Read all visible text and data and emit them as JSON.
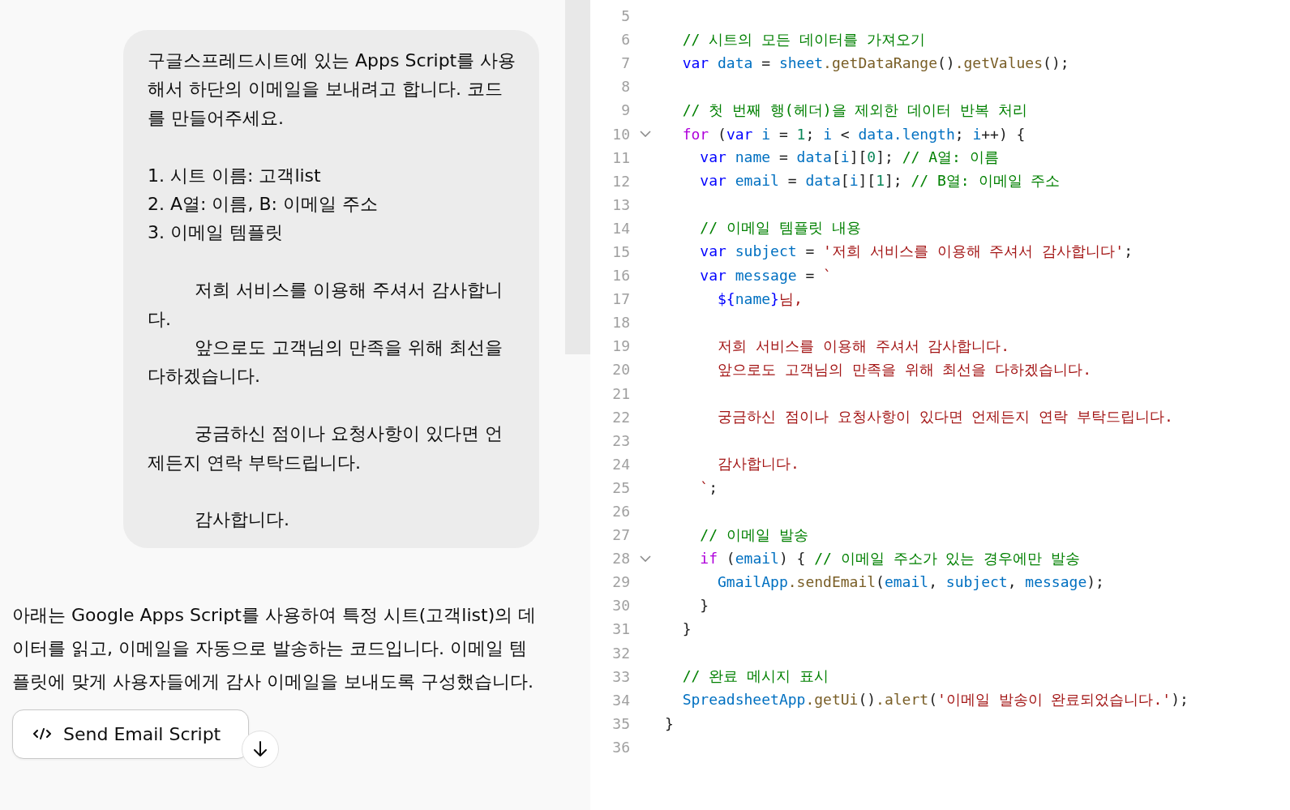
{
  "chat": {
    "user_message": {
      "blocks": [
        [
          "구글스프레드시트에 있는 Apps Script를 사용해서 하단의 이메일을 보내려고 합니다. 코드를 만들어주세요."
        ],
        [
          "1. 시트 이름: 고객list",
          "2. A열: 이름, B: 이메일 주소",
          "3. 이메일 템플릿"
        ],
        [
          "\t저희 서비스를 이용해 주셔서 감사합니다.",
          "\t앞으로도 고객님의 만족을 위해 최선을 다하겠습니다."
        ],
        [
          "\t궁금하신 점이나 요청사항이 있다면 언제든지 연락 부탁드립니다."
        ],
        [
          "\t감사합니다."
        ]
      ]
    },
    "assistant_message": {
      "text": "아래는 Google Apps Script를 사용하여 특정 시트(고객list)의 데이터를 읽고, 이메일을 자동으로 발송하는 코드입니다. 이메일 템플릿에 맞게 사용자들에게 감사 이메일을 보내도록 구성했습니다."
    },
    "artifact_button": {
      "label": "Send Email Script"
    }
  },
  "code_editor": {
    "lines": [
      {
        "number": "5",
        "fold_marker": false
      },
      {
        "number": "6",
        "fold_marker": false,
        "tokens": [
          {
            "kind": "comment",
            "text": "  // 시트의 모든 데이터를 가져오기"
          }
        ]
      },
      {
        "number": "7",
        "fold_marker": false,
        "tokens": [
          {
            "kind": "keyword",
            "text": "  var "
          },
          {
            "kind": "variable",
            "text": "data "
          },
          {
            "kind": "plain",
            "text": "= "
          },
          {
            "kind": "variable",
            "text": "sheet"
          },
          {
            "kind": "function",
            "text": ".getDataRange"
          },
          {
            "kind": "plain",
            "text": "()"
          },
          {
            "kind": "function",
            "text": ".getValues"
          },
          {
            "kind": "plain",
            "text": "();"
          }
        ]
      },
      {
        "number": "8",
        "fold_marker": false
      },
      {
        "number": "9",
        "fold_marker": false,
        "tokens": [
          {
            "kind": "comment",
            "text": "  // 첫 번째 행(헤더)을 제외한 데이터 반복 처리"
          }
        ]
      },
      {
        "number": "10",
        "fold_marker": true,
        "tokens": [
          {
            "kind": "control",
            "text": "  for "
          },
          {
            "kind": "plain",
            "text": "("
          },
          {
            "kind": "keyword",
            "text": "var "
          },
          {
            "kind": "variable",
            "text": "i "
          },
          {
            "kind": "plain",
            "text": "= "
          },
          {
            "kind": "number",
            "text": "1"
          },
          {
            "kind": "plain",
            "text": "; "
          },
          {
            "kind": "variable",
            "text": "i "
          },
          {
            "kind": "plain",
            "text": "< "
          },
          {
            "kind": "variable",
            "text": "data.length"
          },
          {
            "kind": "plain",
            "text": "; "
          },
          {
            "kind": "variable",
            "text": "i"
          },
          {
            "kind": "plain",
            "text": "++) {"
          }
        ]
      },
      {
        "number": "11",
        "fold_marker": false,
        "tokens": [
          {
            "kind": "keyword",
            "text": "    var "
          },
          {
            "kind": "variable",
            "text": "name "
          },
          {
            "kind": "plain",
            "text": "= "
          },
          {
            "kind": "variable",
            "text": "data"
          },
          {
            "kind": "plain",
            "text": "["
          },
          {
            "kind": "variable",
            "text": "i"
          },
          {
            "kind": "plain",
            "text": "]["
          },
          {
            "kind": "number",
            "text": "0"
          },
          {
            "kind": "plain",
            "text": "]; "
          },
          {
            "kind": "comment",
            "text": "// A열: 이름"
          }
        ]
      },
      {
        "number": "12",
        "fold_marker": false,
        "tokens": [
          {
            "kind": "keyword",
            "text": "    var "
          },
          {
            "kind": "variable",
            "text": "email "
          },
          {
            "kind": "plain",
            "text": "= "
          },
          {
            "kind": "variable",
            "text": "data"
          },
          {
            "kind": "plain",
            "text": "["
          },
          {
            "kind": "variable",
            "text": "i"
          },
          {
            "kind": "plain",
            "text": "]["
          },
          {
            "kind": "number",
            "text": "1"
          },
          {
            "kind": "plain",
            "text": "]; "
          },
          {
            "kind": "comment",
            "text": "// B열: 이메일 주소"
          }
        ]
      },
      {
        "number": "13",
        "fold_marker": false
      },
      {
        "number": "14",
        "fold_marker": false,
        "tokens": [
          {
            "kind": "comment",
            "text": "    // 이메일 템플릿 내용"
          }
        ]
      },
      {
        "number": "15",
        "fold_marker": false,
        "tokens": [
          {
            "kind": "keyword",
            "text": "    var "
          },
          {
            "kind": "variable",
            "text": "subject "
          },
          {
            "kind": "plain",
            "text": "= "
          },
          {
            "kind": "string",
            "text": "'저희 서비스를 이용해 주셔서 감사합니다'"
          },
          {
            "kind": "plain",
            "text": ";"
          }
        ]
      },
      {
        "number": "16",
        "fold_marker": false,
        "tokens": [
          {
            "kind": "keyword",
            "text": "    var "
          },
          {
            "kind": "variable",
            "text": "message "
          },
          {
            "kind": "plain",
            "text": "= "
          },
          {
            "kind": "string",
            "text": "`"
          }
        ]
      },
      {
        "number": "17",
        "fold_marker": false,
        "tokens": [
          {
            "kind": "keyword",
            "text": "      ${"
          },
          {
            "kind": "variable",
            "text": "name"
          },
          {
            "kind": "keyword",
            "text": "}"
          },
          {
            "kind": "string",
            "text": "님,"
          }
        ]
      },
      {
        "number": "18",
        "fold_marker": false
      },
      {
        "number": "19",
        "fold_marker": false,
        "tokens": [
          {
            "kind": "string",
            "text": "      저희 서비스를 이용해 주셔서 감사합니다."
          }
        ]
      },
      {
        "number": "20",
        "fold_marker": false,
        "tokens": [
          {
            "kind": "string",
            "text": "      앞으로도 고객님의 만족을 위해 최선을 다하겠습니다."
          }
        ]
      },
      {
        "number": "21",
        "fold_marker": false
      },
      {
        "number": "22",
        "fold_marker": false,
        "tokens": [
          {
            "kind": "string",
            "text": "      궁금하신 점이나 요청사항이 있다면 언제든지 연락 부탁드립니다."
          }
        ]
      },
      {
        "number": "23",
        "fold_marker": false
      },
      {
        "number": "24",
        "fold_marker": false,
        "tokens": [
          {
            "kind": "string",
            "text": "      감사합니다."
          }
        ]
      },
      {
        "number": "25",
        "fold_marker": false,
        "tokens": [
          {
            "kind": "string",
            "text": "    `"
          },
          {
            "kind": "plain",
            "text": ";"
          }
        ]
      },
      {
        "number": "26",
        "fold_marker": false
      },
      {
        "number": "27",
        "fold_marker": false,
        "tokens": [
          {
            "kind": "comment",
            "text": "    // 이메일 발송"
          }
        ]
      },
      {
        "number": "28",
        "fold_marker": true,
        "tokens": [
          {
            "kind": "control",
            "text": "    if "
          },
          {
            "kind": "plain",
            "text": "("
          },
          {
            "kind": "variable",
            "text": "email"
          },
          {
            "kind": "plain",
            "text": ") { "
          },
          {
            "kind": "comment",
            "text": "// 이메일 주소가 있는 경우에만 발송"
          }
        ]
      },
      {
        "number": "29",
        "fold_marker": false,
        "tokens": [
          {
            "kind": "variable",
            "text": "      GmailApp"
          },
          {
            "kind": "function",
            "text": ".sendEmail"
          },
          {
            "kind": "plain",
            "text": "("
          },
          {
            "kind": "variable",
            "text": "email"
          },
          {
            "kind": "plain",
            "text": ", "
          },
          {
            "kind": "variable",
            "text": "subject"
          },
          {
            "kind": "plain",
            "text": ", "
          },
          {
            "kind": "variable",
            "text": "message"
          },
          {
            "kind": "plain",
            "text": ");"
          }
        ]
      },
      {
        "number": "30",
        "fold_marker": false,
        "tokens": [
          {
            "kind": "plain",
            "text": "    }"
          }
        ]
      },
      {
        "number": "31",
        "fold_marker": false,
        "tokens": [
          {
            "kind": "plain",
            "text": "  }"
          }
        ]
      },
      {
        "number": "32",
        "fold_marker": false
      },
      {
        "number": "33",
        "fold_marker": false,
        "tokens": [
          {
            "kind": "comment",
            "text": "  // 완료 메시지 표시"
          }
        ]
      },
      {
        "number": "34",
        "fold_marker": false,
        "tokens": [
          {
            "kind": "variable",
            "text": "  SpreadsheetApp"
          },
          {
            "kind": "function",
            "text": ".getUi"
          },
          {
            "kind": "plain",
            "text": "()"
          },
          {
            "kind": "function",
            "text": ".alert"
          },
          {
            "kind": "plain",
            "text": "("
          },
          {
            "kind": "string",
            "text": "'이메일 발송이 완료되었습니다.'"
          },
          {
            "kind": "plain",
            "text": ");"
          }
        ]
      },
      {
        "number": "35",
        "fold_marker": false,
        "tokens": [
          {
            "kind": "plain",
            "text": "}"
          }
        ]
      },
      {
        "number": "36",
        "fold_marker": false
      }
    ]
  }
}
